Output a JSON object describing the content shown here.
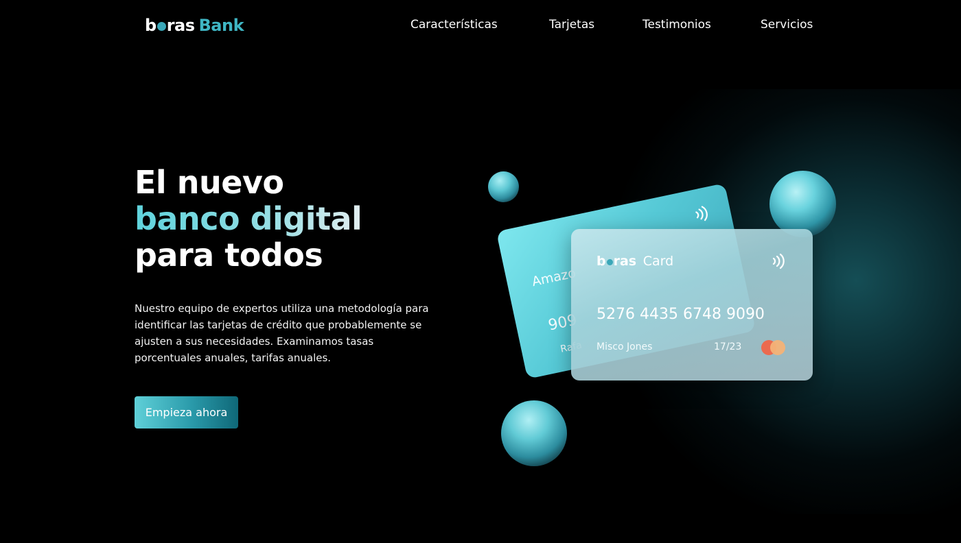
{
  "header": {
    "logo_prefix_start": "b",
    "logo_prefix_end": "ras",
    "logo_suffix": "Bank",
    "nav": [
      "Características",
      "Tarjetas",
      "Testimonios",
      "Servicios"
    ]
  },
  "hero": {
    "headline_line1": "El nuevo",
    "headline_line2": "banco digital",
    "headline_line3": "para todos",
    "description": "Nuestro equipo de expertos utiliza una metodología para identificar las tarjetas de crédito que probablemente se ajusten a sus necesidades. Examinamos tasas porcentuales anuales, tarifas anuales.",
    "cta_label": "Empieza ahora"
  },
  "back_card": {
    "brand_partial": "Amazo",
    "number_partial": "909",
    "holder_partial": "Rafa"
  },
  "front_card": {
    "brand_start": "b",
    "brand_end": "ras",
    "brand_suffix": "Card",
    "number": "5276 4435 6748 9090",
    "holder": "Misco Jones",
    "expiry": "17/23"
  },
  "colors": {
    "accent": "#3fb6c4",
    "gradient_start": "#5fd0d8",
    "gradient_end": "#0f6878",
    "mc_left": "#eb6a4f",
    "mc_right": "#f4b277"
  },
  "icons": [
    "contactless-icon",
    "mastercard-logo"
  ]
}
